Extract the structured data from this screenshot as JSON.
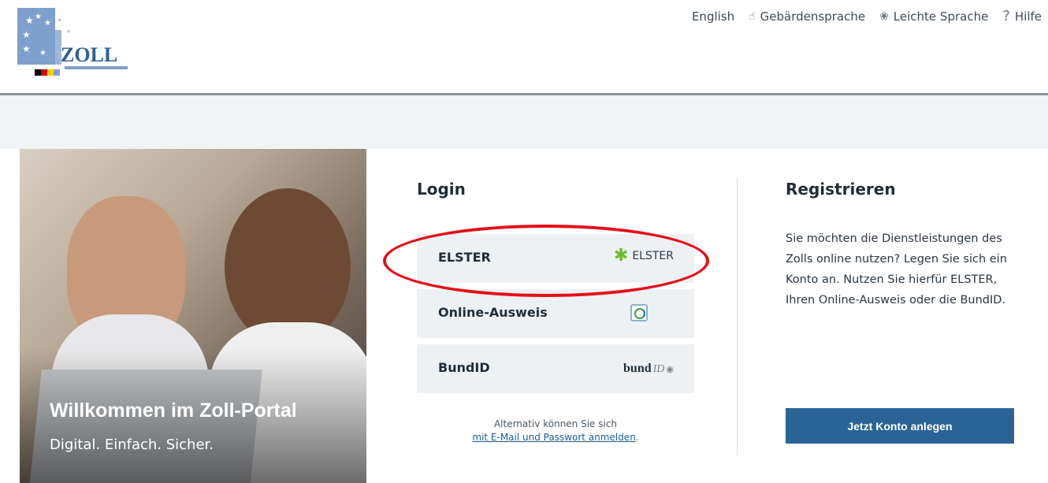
{
  "header": {
    "logo_text": "ZOLL",
    "links": [
      {
        "label": "English",
        "icon": "none"
      },
      {
        "label": "Gebärdensprache",
        "icon": "sign-language-icon"
      },
      {
        "label": "Leichte Sprache",
        "icon": "easy-language-icon"
      },
      {
        "label": "Hilfe",
        "icon": "help-icon"
      }
    ]
  },
  "hero": {
    "title": "Willkommen im Zoll-Portal",
    "subtitle": "Digital. Einfach. Sicher."
  },
  "login": {
    "title": "Login",
    "options": [
      {
        "label": "ELSTER",
        "logo_text": "ELSTER"
      },
      {
        "label": "Online-Ausweis"
      },
      {
        "label": "BundID",
        "logo_word": "bund",
        "logo_id": "ID"
      }
    ],
    "alt_text": "Alternativ können Sie sich",
    "alt_link": "mit E-Mail und Passwort anmelden",
    "alt_suffix": "."
  },
  "register": {
    "title": "Registrieren",
    "text": "Sie möchten die Dienstleistungen des Zolls online nutzen? Legen Sie sich ein Konto an. Nutzen Sie hierfür ELSTER, Ihren Online-Ausweis oder die BundID.",
    "button": "Jetzt Konto anlegen"
  },
  "colors": {
    "annotation_circle": "#e3101a",
    "button_bg": "#2a6496",
    "elster_green": "#6bbd2b"
  }
}
